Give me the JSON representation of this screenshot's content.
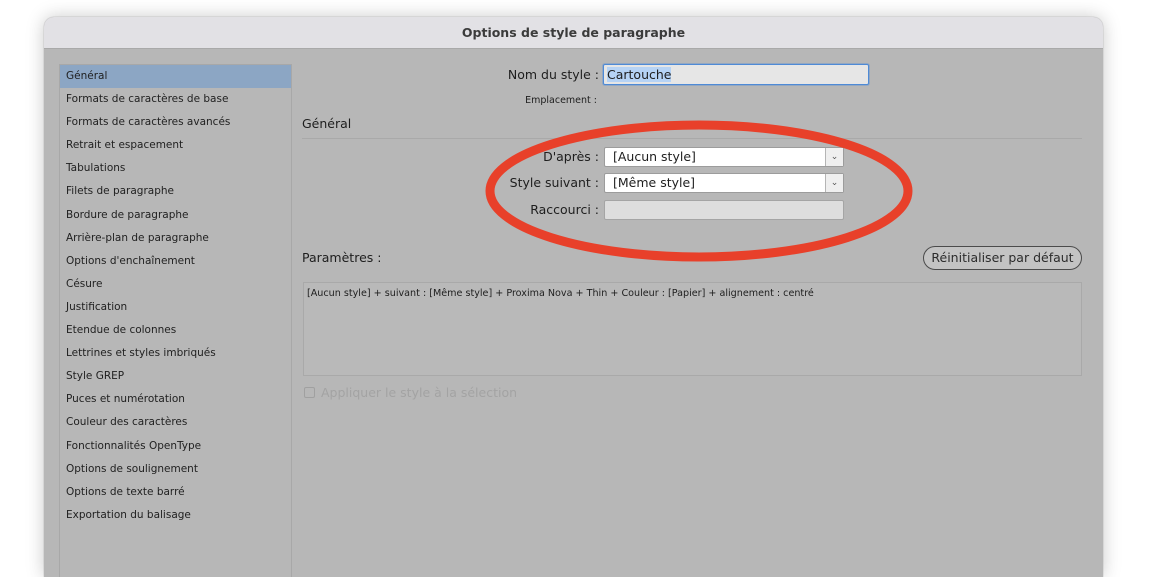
{
  "window": {
    "title": "Options de style de paragraphe"
  },
  "sidebar": {
    "items": [
      {
        "label": "Général",
        "selected": true
      },
      {
        "label": "Formats de caractères de base"
      },
      {
        "label": "Formats de caractères avancés"
      },
      {
        "label": "Retrait et espacement"
      },
      {
        "label": "Tabulations"
      },
      {
        "label": "Filets de paragraphe"
      },
      {
        "label": "Bordure de paragraphe"
      },
      {
        "label": "Arrière-plan de paragraphe"
      },
      {
        "label": "Options d'enchaînement"
      },
      {
        "label": "Césure"
      },
      {
        "label": "Justification"
      },
      {
        "label": "Etendue de colonnes"
      },
      {
        "label": "Lettrines et styles imbriqués"
      },
      {
        "label": "Style GREP"
      },
      {
        "label": "Puces et numérotation"
      },
      {
        "label": "Couleur des caractères"
      },
      {
        "label": "Fonctionnalités OpenType"
      },
      {
        "label": "Options de soulignement"
      },
      {
        "label": "Options de texte barré"
      },
      {
        "label": "Exportation du balisage"
      }
    ]
  },
  "form": {
    "style_name_label": "Nom du style :",
    "style_name_value": "Cartouche",
    "location_label": "Emplacement :",
    "section_title": "Général",
    "based_on_label": "D'après :",
    "based_on_value": "[Aucun style]",
    "next_style_label": "Style suivant :",
    "next_style_value": "[Même style]",
    "shortcut_label": "Raccourci :",
    "shortcut_value": "",
    "params_label": "Paramètres :",
    "reset_button": "Réinitialiser par défaut",
    "params_text": "[Aucun style] + suivant : [Même style] + Proxima Nova + Thin + Couleur : [Papier] + alignement : centré",
    "apply_label": "Appliquer le style à la sélection",
    "apply_checked": false
  },
  "annotation": {
    "color": "#e8402a",
    "shape": "ellipse",
    "target": "D'après / Style suivant / Raccourci fields"
  }
}
